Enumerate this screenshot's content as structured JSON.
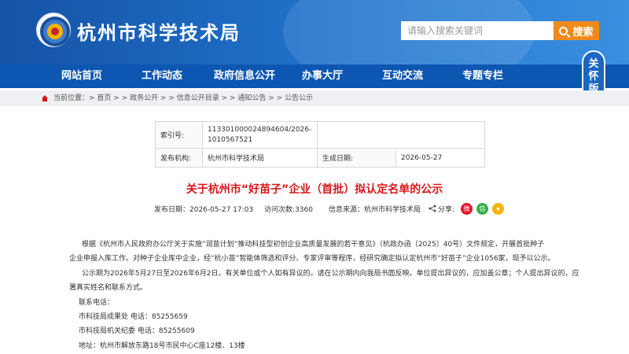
{
  "header": {
    "site_title": "杭州市科学技术局",
    "search_placeholder": "请输入搜索关键词",
    "search_button": "搜索"
  },
  "nav": [
    "网站首页",
    "工作动态",
    "政府信息公开",
    "办事大厅",
    "互动交流",
    "专题专栏"
  ],
  "care_mode": {
    "chars": [
      "关",
      "怀",
      "版"
    ]
  },
  "breadcrumb": "当前位置：> 首页 > > 政务公开 > > 信息公开目录 > > 通知公告 > > 公告公示",
  "meta": {
    "index_label": "索引号:",
    "index_value_line1": "113301000024894604/2026-",
    "index_value_line2": "1010567521",
    "org_label": "发布机构:",
    "org_value": "杭州市科学技术局",
    "date_label": "生成日期:",
    "date_value": "2026-05-27"
  },
  "article": {
    "title": "关于杭州市“好苗子”企业（首批）拟认定名单的公示",
    "publish_date": "发布日期：2026-05-27 17:03",
    "views": "访问次数:3360",
    "source": "信息来源：杭州市科学技术局",
    "share_label": "分享:",
    "paragraphs": [
      "根据《杭州市人民政府办公厅关于实施“润苗计划”推动科技型初创企业高质量发展的若干意见》（杭政办函〔2025〕40号）文件规定，开展首批种子",
      "企业申报入库工作。对种子企业库中企业，经“杭小苗”智能体筛选和评分、专家评审等程序，经研究确定拟认定杭州市“好苗子”企业1056家，现予以公示。",
      "公示期为2026年5月27日至2026年6月2日。有关单位或个人如有异议的，请在公示期内向我局书面反映。单位提出异议的，应加盖公章；个人提出异议的，应",
      "署真实姓名和联系方式。",
      "联系电话：",
      "市科技局成果处 电话：85255659",
      "市科技局机关纪委 电话：85255609",
      "地址：杭州市解放东路18号市民中心C座12楼、13楼"
    ]
  },
  "colors": {
    "banner": "#1f6fc7",
    "nav": "#0d56b1",
    "title": "#d8171b",
    "search_button": "#f08a1c"
  }
}
